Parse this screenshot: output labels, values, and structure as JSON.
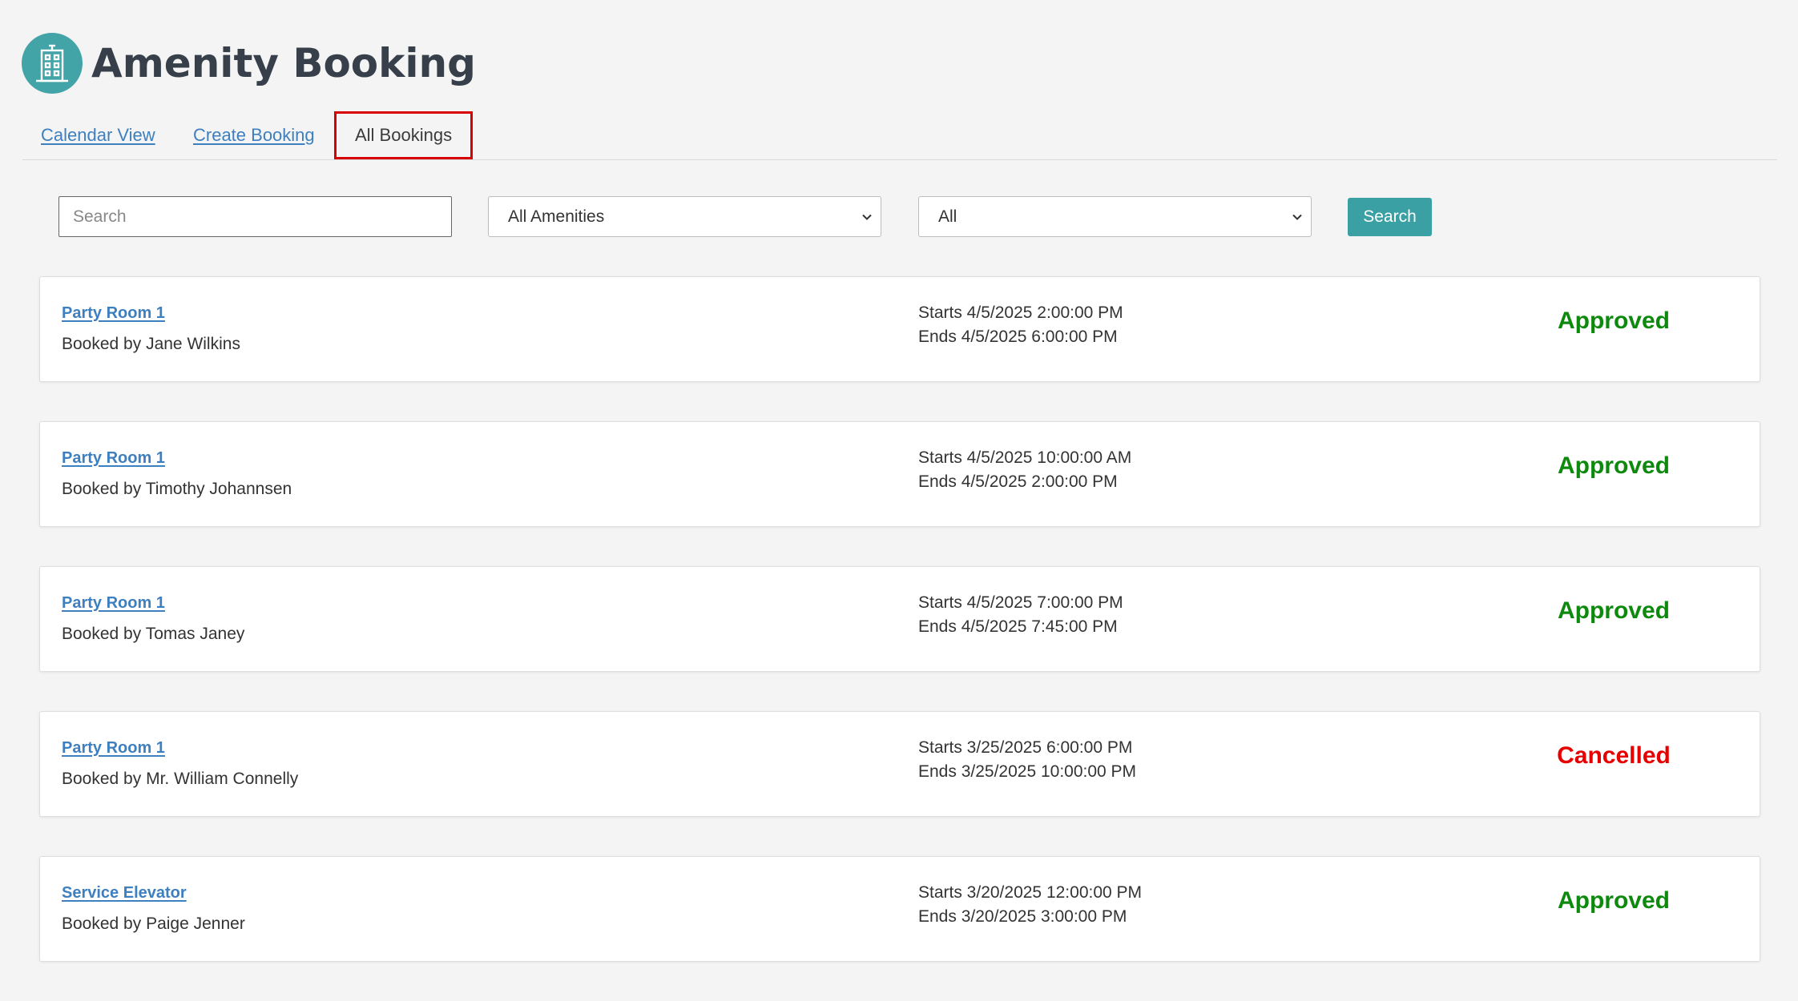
{
  "app": {
    "title": "Amenity Booking",
    "logo_icon": "building-icon",
    "accent_color": "#43a4a8"
  },
  "tabs": [
    {
      "label": "Calendar View",
      "active": false
    },
    {
      "label": "Create Booking",
      "active": false
    },
    {
      "label": "All Bookings",
      "active": true
    }
  ],
  "filters": {
    "search_placeholder": "Search",
    "search_value": "",
    "amenity_select": {
      "selected": "All Amenities"
    },
    "status_select": {
      "selected": "All"
    },
    "search_button_label": "Search"
  },
  "bookings": [
    {
      "amenity": "Party Room 1",
      "booked_by": "Booked by Jane Wilkins",
      "starts": "Starts 4/5/2025 2:00:00 PM",
      "ends": "Ends 4/5/2025 6:00:00 PM",
      "status": "Approved",
      "status_color": "#0d8a0d"
    },
    {
      "amenity": "Party Room 1",
      "booked_by": "Booked by Timothy Johannsen",
      "starts": "Starts 4/5/2025 10:00:00 AM",
      "ends": "Ends 4/5/2025 2:00:00 PM",
      "status": "Approved",
      "status_color": "#0d8a0d"
    },
    {
      "amenity": "Party Room 1",
      "booked_by": "Booked by Tomas Janey",
      "starts": "Starts 4/5/2025 7:00:00 PM",
      "ends": "Ends 4/5/2025 7:45:00 PM",
      "status": "Approved",
      "status_color": "#0d8a0d"
    },
    {
      "amenity": "Party Room 1",
      "booked_by": "Booked by Mr. William Connelly",
      "starts": "Starts 3/25/2025 6:00:00 PM",
      "ends": "Ends 3/25/2025 10:00:00 PM",
      "status": "Cancelled",
      "status_color": "#e60000"
    },
    {
      "amenity": "Service Elevator",
      "booked_by": "Booked by Paige Jenner",
      "starts": "Starts 3/20/2025 12:00:00 PM",
      "ends": "Ends 3/20/2025 3:00:00 PM",
      "status": "Approved",
      "status_color": "#0d8a0d"
    }
  ]
}
